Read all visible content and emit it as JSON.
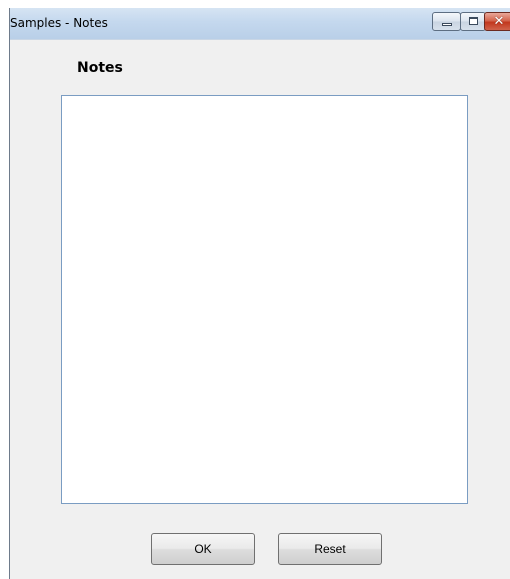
{
  "window": {
    "title": "Samples - Notes",
    "controls": {
      "minimize_icon": "minimize-icon",
      "maximize_icon": "maximize-icon",
      "close_icon": "close-icon",
      "close_glyph": "✕"
    }
  },
  "notes": {
    "label": "Notes",
    "value": "",
    "placeholder": ""
  },
  "buttons": {
    "ok_label": "OK",
    "reset_label": "Reset"
  },
  "colors": {
    "titlebar": "#c4d8ee",
    "close_button": "#c2371d",
    "window_background": "#f0f0f0",
    "textbox_border": "#7a9cc2"
  }
}
